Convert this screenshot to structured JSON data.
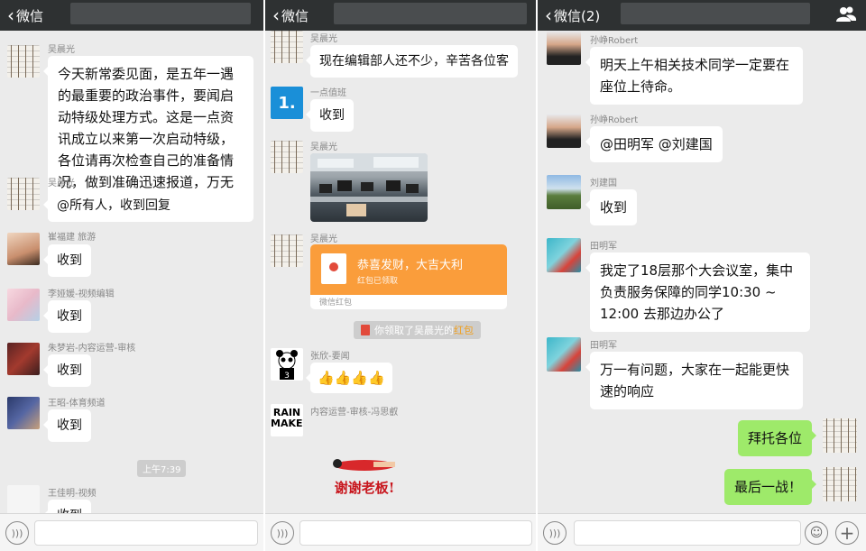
{
  "colors": {
    "topbar": "#2e3132",
    "bubble_green": "#9eea6a",
    "chat_bg": "#ebebeb",
    "redpacket": "#fa9d3b"
  },
  "panel1": {
    "back_label": "微信",
    "messages": [
      {
        "sender": "吴晨光",
        "text": "今天新常委见面，是五年一遇的最重要的政治事件，要闻启动特级处理方式。这是一点资讯成立以来第一次启动特级，各位请再次检查自己的准备情况，做到准确迅速报道，万无一失！"
      },
      {
        "sender": "吴晨光",
        "text": "@所有人，收到回复"
      },
      {
        "sender": "崔福建 旅游",
        "text": "收到"
      },
      {
        "sender": "李娅媛-视频编辑",
        "text": "收到"
      },
      {
        "sender": "朱梦岩-内容运营-审核",
        "text": "收到"
      },
      {
        "sender": "王昭-体育频道",
        "text": "收到"
      },
      {
        "sender": "王佳明-视频",
        "text": "收到"
      }
    ],
    "timestamp": "上午7:39"
  },
  "panel2": {
    "back_label": "微信",
    "messages": [
      {
        "sender": "吴晨光",
        "text": "现在编辑部人还不少，辛苦各位客"
      },
      {
        "sender": "一点值班",
        "text": "收到"
      },
      {
        "sender": "吴晨光"
      },
      {
        "sender": "吴晨光"
      },
      {
        "sender": "张欣-要闻",
        "text": "👍👍👍👍"
      },
      {
        "sender": "内容运营-审核-冯思叡"
      }
    ],
    "redpacket": {
      "title": "恭喜发财，大吉大利",
      "subtitle": "红包已领取",
      "footer": "微信红包"
    },
    "system_note": {
      "prefix": "你领取了吴晨光的",
      "highlight": "红包"
    },
    "sticker_text": "谢谢老板!",
    "avatar_text": "RAIN MAKER",
    "avatar_badge": "1."
  },
  "panel3": {
    "back_label": "微信(2)",
    "messages": [
      {
        "sender": "孙峥Robert",
        "text": "明天上午相关技术同学一定要在座位上待命。"
      },
      {
        "sender": "孙峥Robert",
        "text": "@田明军 @刘建国"
      },
      {
        "sender": "刘建国",
        "text": "收到"
      },
      {
        "sender": "田明军",
        "text": "我定了18层那个大会议室，集中负责服务保障的同学10:30 ~ 12:00 去那边办公了"
      },
      {
        "sender": "田明军",
        "text": "万一有问题，大家在一起能更快速的响应"
      }
    ],
    "own_messages": [
      "拜托各位",
      "最后一战！"
    ]
  }
}
